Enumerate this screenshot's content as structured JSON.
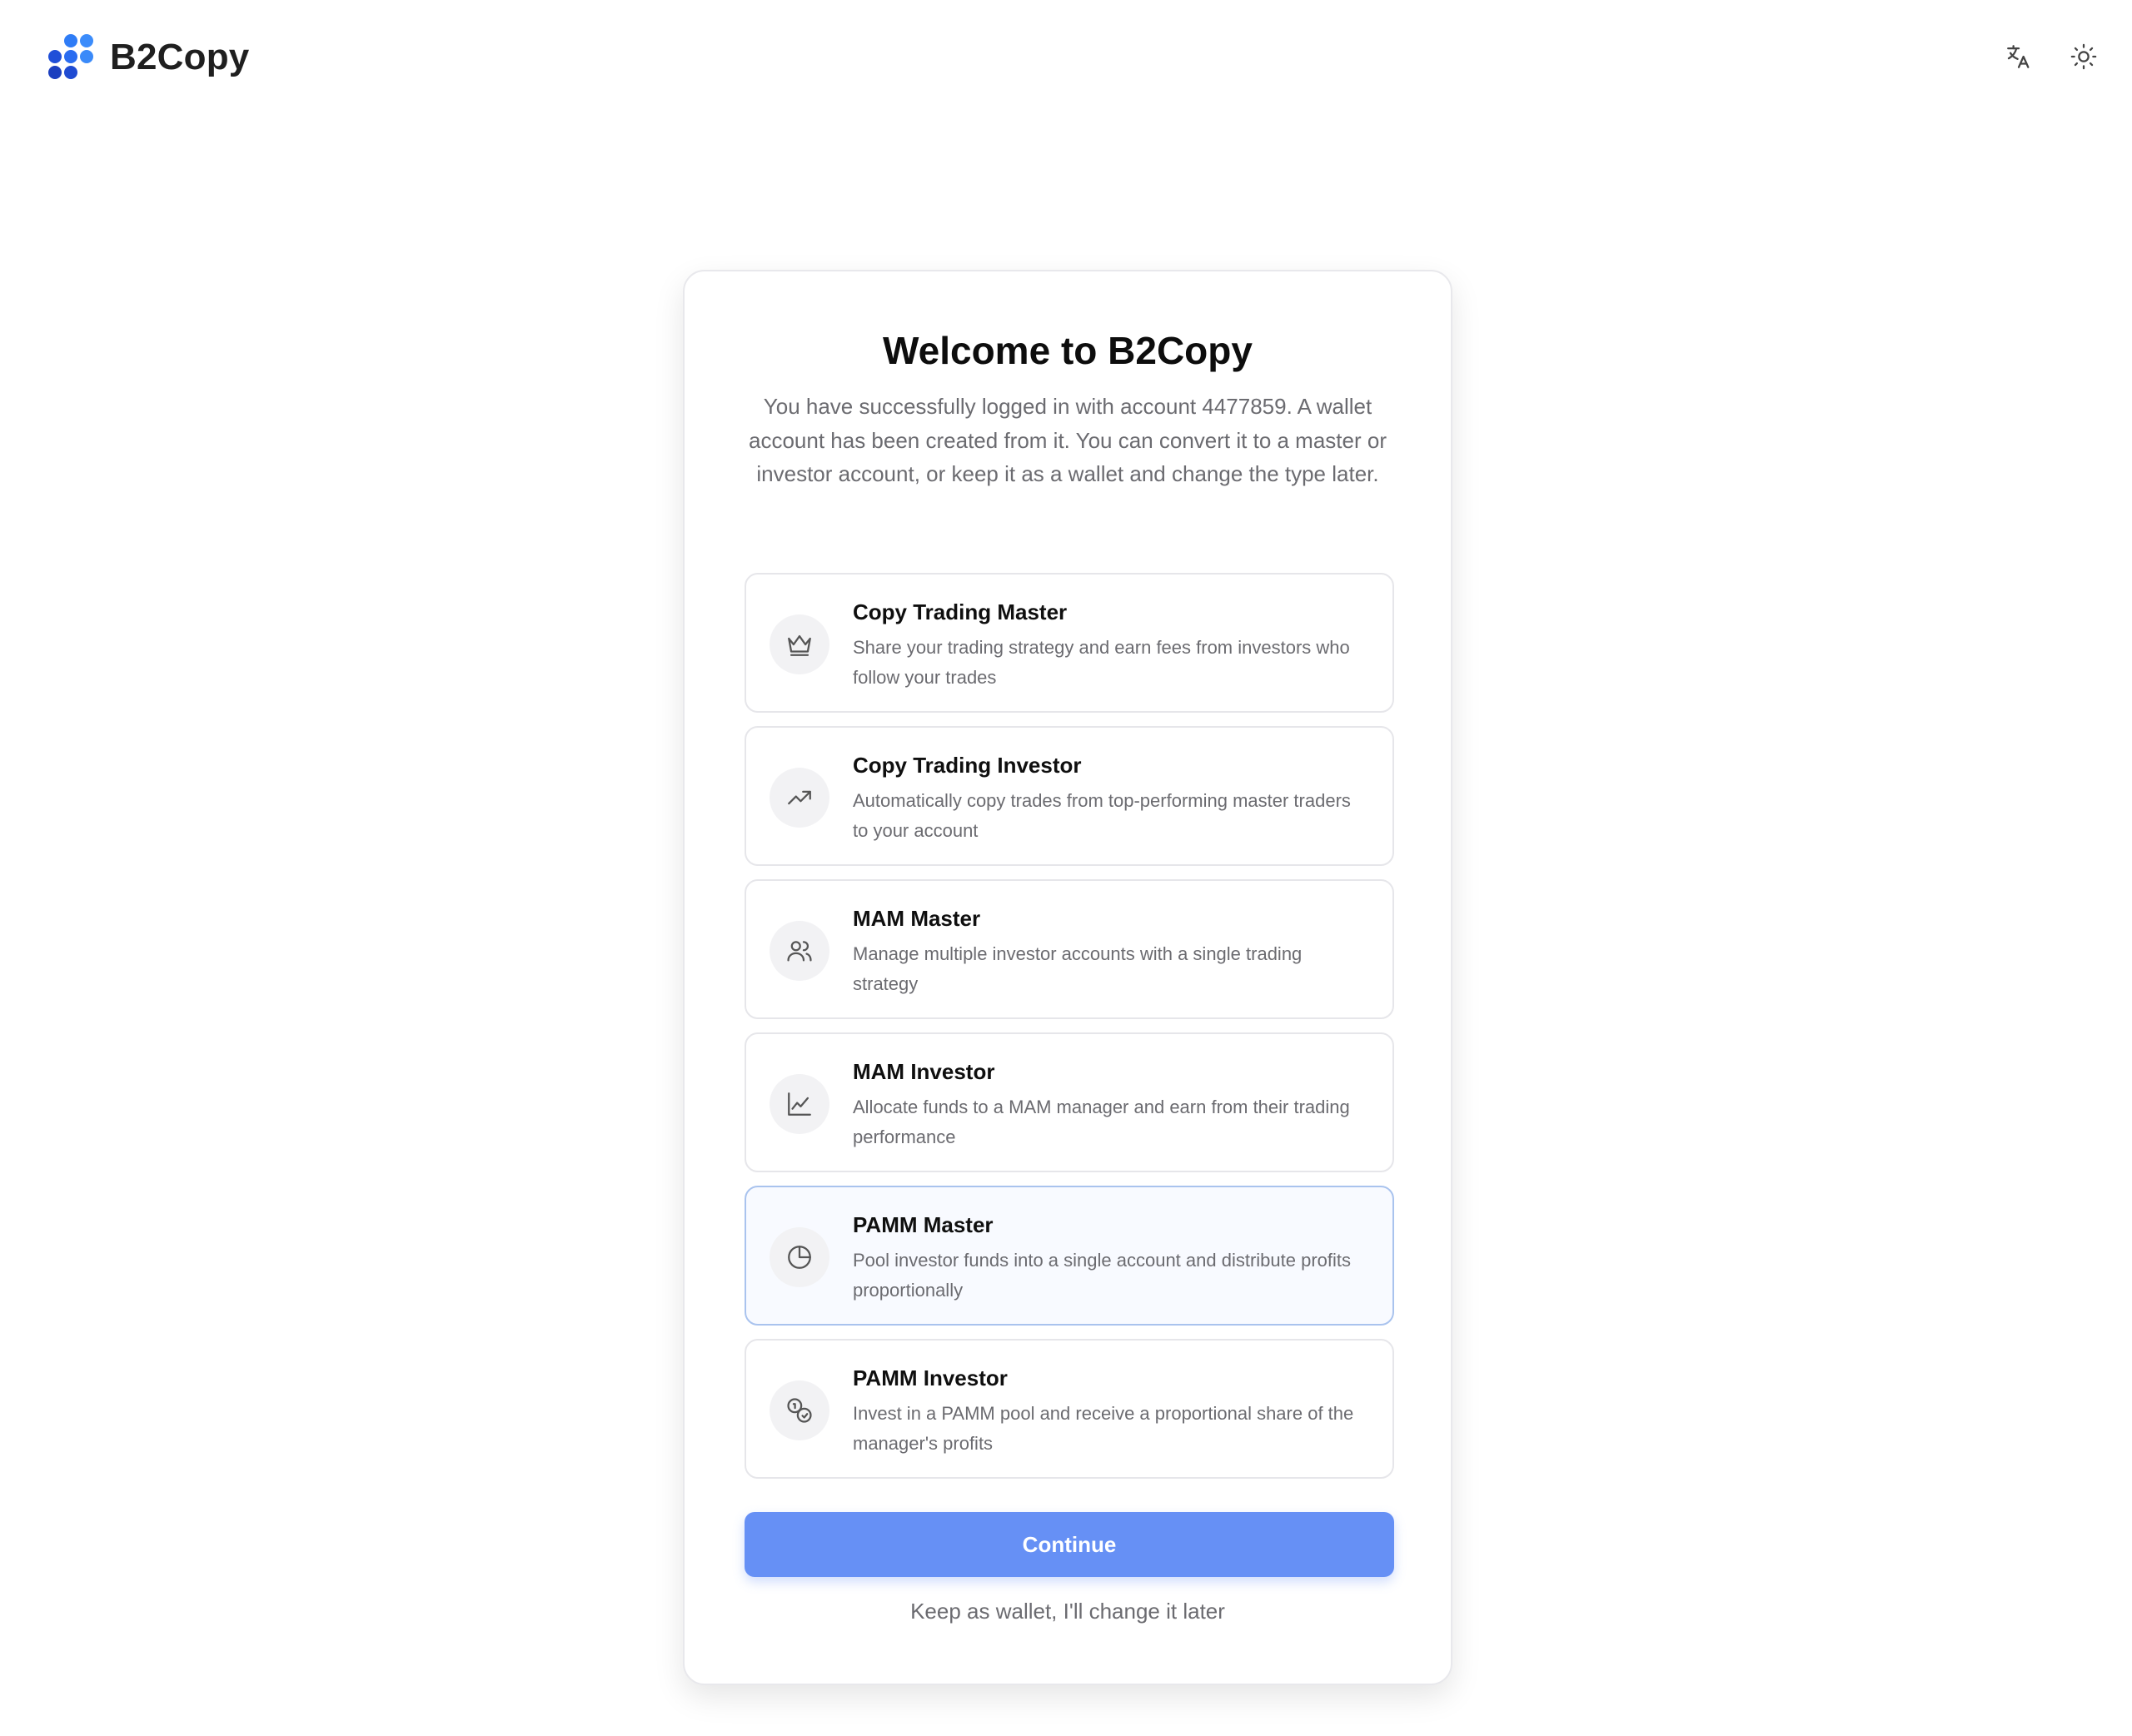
{
  "brand": {
    "name": "B2Copy",
    "logo_icon": "b2copy-dots-logo"
  },
  "header_actions": [
    {
      "icon": "translate-icon"
    },
    {
      "icon": "sun-icon"
    }
  ],
  "welcome": {
    "title": "Welcome to B2Copy",
    "message": "You have successfully logged in with account 4477859. A wallet account has been created from it. You can convert it to a master or investor account, or keep it as a wallet and change the type later."
  },
  "options": [
    {
      "title": "Copy Trading Master",
      "description": "Share your trading strategy and earn fees from investors who follow your trades",
      "icon": "crown-icon"
    },
    {
      "title": "Copy Trading Investor",
      "description": "Automatically copy trades from top-performing master traders to your account",
      "icon": "trending-up-icon"
    },
    {
      "title": "MAM Master",
      "description": "Manage multiple investor accounts with a single trading strategy",
      "icon": "users-icon"
    },
    {
      "title": "MAM Investor",
      "description": "Allocate funds to a MAM manager and earn from their trading performance",
      "icon": "line-chart-icon"
    },
    {
      "title": "PAMM Master",
      "description": "Pool investor funds into a single account and distribute profits proportionally",
      "icon": "pie-chart-icon"
    },
    {
      "title": "PAMM Investor",
      "description": "Invest in a PAMM pool and receive a proportional share of the manager's profits",
      "icon": "coins-icon"
    }
  ],
  "actions": {
    "continue_label": "Continue",
    "keep_wallet_label": "Keep as wallet, I'll change it later"
  },
  "colors": {
    "accent": "#6690f5",
    "highlight_border": "#a9c3ee",
    "highlight_bg": "#f8faff",
    "muted_text": "#6b6b70"
  }
}
